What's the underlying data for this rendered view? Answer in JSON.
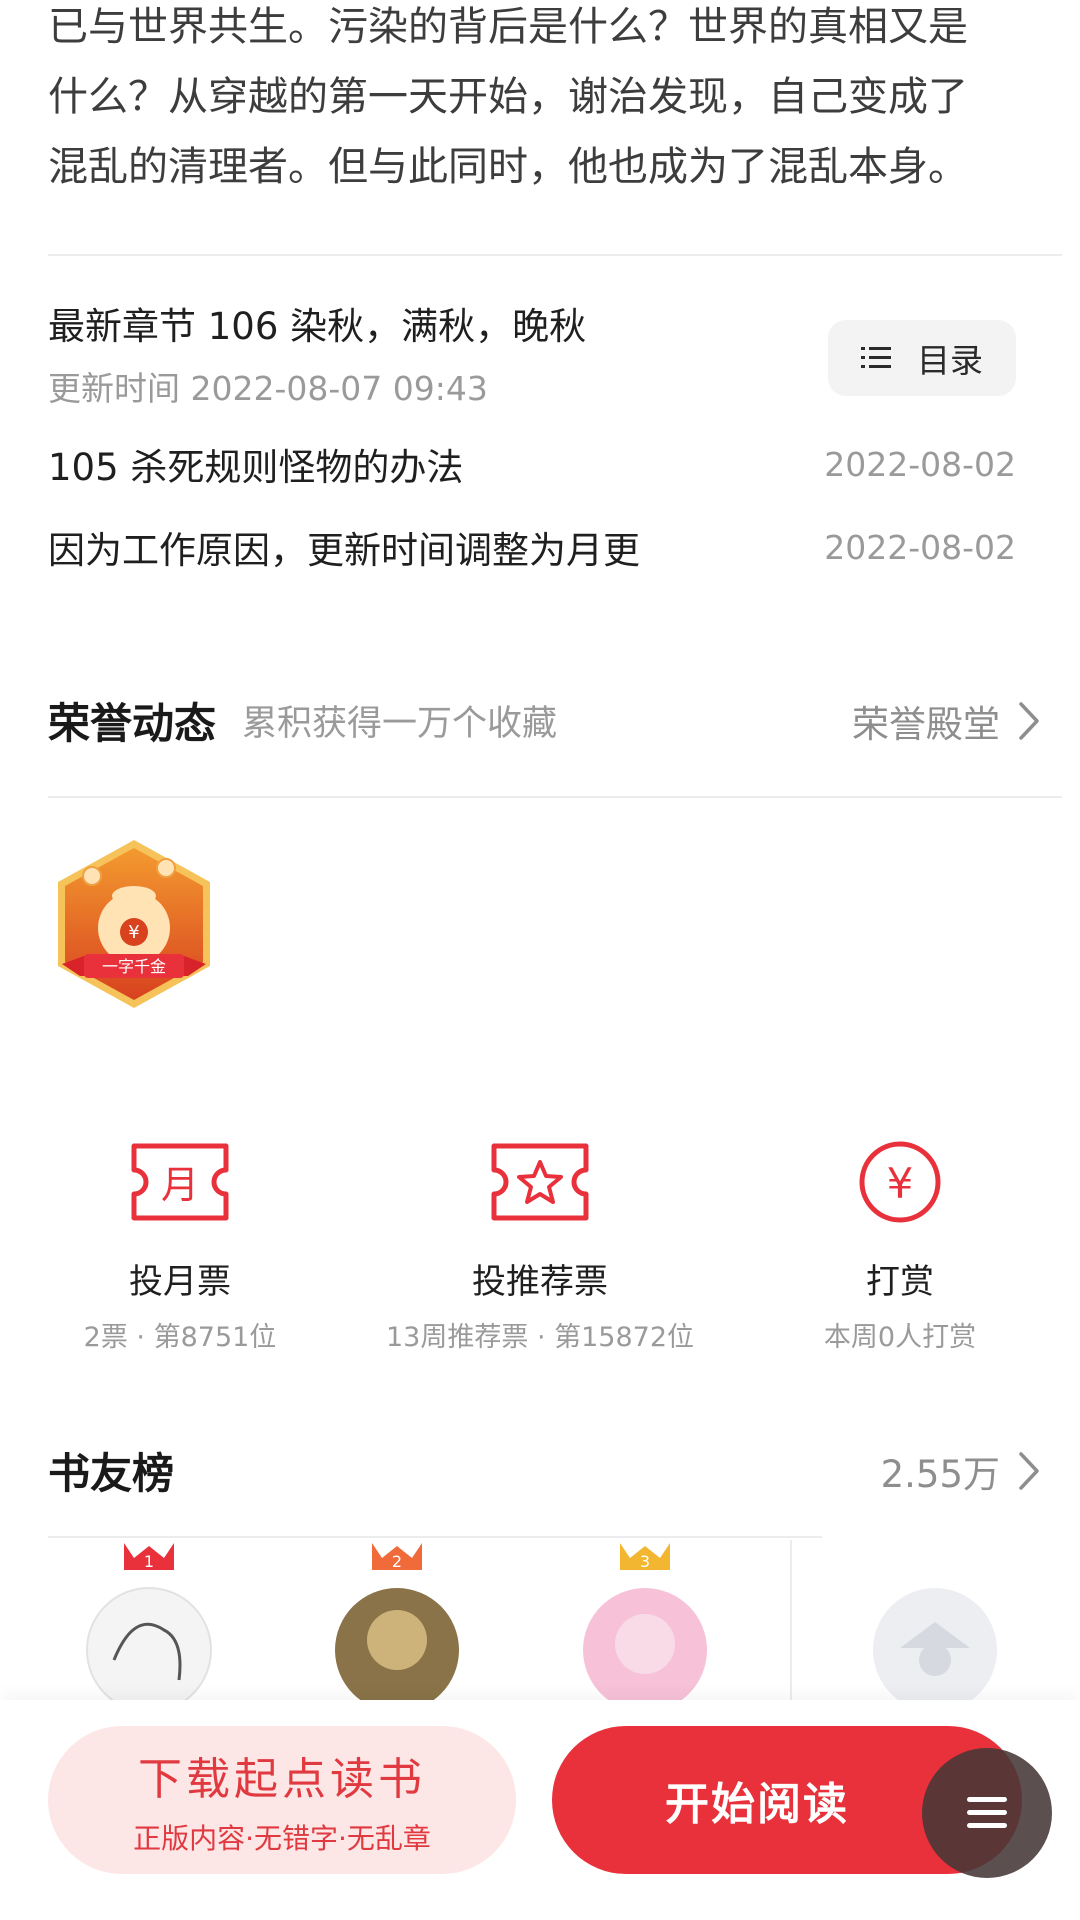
{
  "intro": {
    "lines": [
      "已与世界共生。污染的背后是什么？世界的真相又是",
      "什么？从穿越的第一天开始，谢治发现，自己变成了",
      "混乱的清理者。但与此同时，他也成为了混乱本身。"
    ]
  },
  "latest": {
    "title": "最新章节 106 染秋，满秋，晚秋",
    "update_time": "更新时间 2022-08-07 09:43",
    "toc_label": "目录"
  },
  "chapters": [
    {
      "title": "105 杀死规则怪物的办法",
      "date": "2022-08-02"
    },
    {
      "title": "因为工作原因，更新时间调整为月更",
      "date": "2022-08-02"
    }
  ],
  "honor": {
    "title": "荣誉动态",
    "subtitle": "累积获得一万个收藏",
    "more_label": "荣誉殿堂",
    "badge_text": "一字千金"
  },
  "actions": [
    {
      "icon": "month-ticket-icon",
      "icon_char": "月",
      "label": "投月票",
      "sub": "2票 · 第8751位"
    },
    {
      "icon": "recommend-ticket-icon",
      "label": "投推荐票",
      "sub": "13周推荐票 · 第15872位"
    },
    {
      "icon": "reward-icon",
      "icon_char": "¥",
      "label": "打赏",
      "sub": "本周0人打赏"
    }
  ],
  "fans": {
    "title": "书友榜",
    "count": "2.55万",
    "ranks": [
      {
        "rank": "1",
        "crown_color": "#e8313b"
      },
      {
        "rank": "2",
        "crown_color": "#f06a3a"
      },
      {
        "rank": "3",
        "crown_color": "#f2b630"
      }
    ]
  },
  "bottom": {
    "download_title": "下载起点读书",
    "download_sub": "正版内容·无错字·无乱章",
    "read_label": "开始阅读"
  },
  "colors": {
    "accent": "#e8313b",
    "download_bg": "#fde6e6",
    "muted_text": "#9a9a9a"
  }
}
